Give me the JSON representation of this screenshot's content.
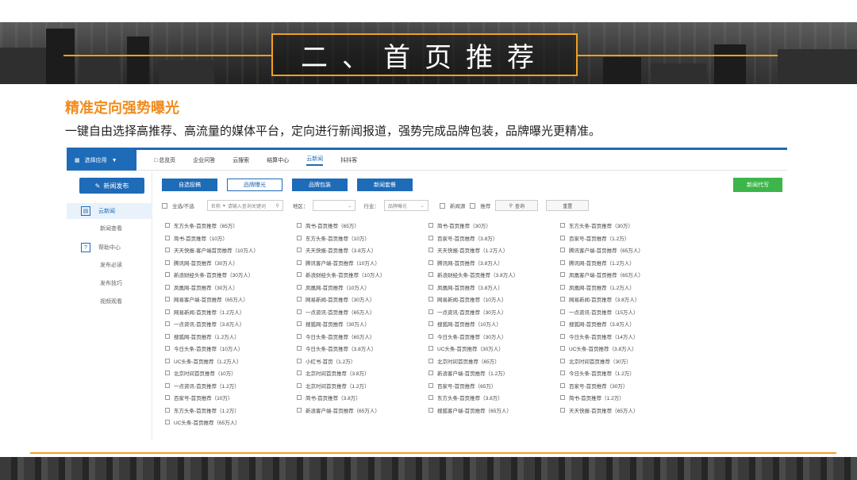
{
  "banner": {
    "title": "二、首页推荐"
  },
  "heading": "精准定向强势曝光",
  "subtitle": "一键自由选择高推荐、高流量的媒体平台，定向进行新闻报道，强势完成品牌包装，品牌曝光更精准。",
  "topnav": {
    "app_select": "选择应用",
    "items": [
      "总览页",
      "企业问答",
      "云搜索",
      "结算中心",
      "云新闻",
      "抖抖客"
    ],
    "active": "云新闻"
  },
  "sidebar": {
    "publish": "新闻发布",
    "group1": "云新闻",
    "group1_sub": "新闻查看",
    "group2": "帮助中心",
    "group2_subs": [
      "发布必读",
      "发布技巧",
      "视频观看"
    ]
  },
  "tabs": [
    "自选投稿",
    "品牌曝光",
    "品牌包装",
    "新闻套餐"
  ],
  "write_button": "新闻代写",
  "filter": {
    "select_all": "全选/不选",
    "name_label": "名称",
    "name_placeholder": "请输入查询关键词",
    "region_label": "地区：",
    "industry_label": "行业：",
    "industry_value": "品牌曝光",
    "option_a": "新闻源",
    "option_b": "推荐",
    "query": "查询",
    "reset": "重置"
  },
  "items": [
    [
      "东方头条-首页推荐（65万）",
      "简书-首页推荐（65万）",
      "简书-首页推荐（30万）",
      "东方头条-首页推荐（30万）"
    ],
    [
      "简书-首页推荐（10万）",
      "东方头条-首页推荐（10万）",
      "百家号-首页推荐（3.8万）",
      "百家号-首页推荐（1.2万）"
    ],
    [
      "天天快报-客户端首页推荐（10万人）",
      "天天快报-首页推荐（3.8万人）",
      "天天快报-首页推荐（1.2万人）",
      "腾讯客户端-首页推荐（65万人）"
    ],
    [
      "腾讯网-首页推荐（30万人）",
      "腾讯客户端-首页推荐（10万人）",
      "腾讯网-首页推荐（3.8万人）",
      "腾讯网-首页推荐（1.2万人）"
    ],
    [
      "新浪财经头条-首页推荐（30万人）",
      "新浪财经头条-首页推荐（10万人）",
      "新浪财经头条-首页推荐（3.8万人）",
      "凤凰客户端-首页推荐（65万人）"
    ],
    [
      "凤凰网-首页推荐（30万人）",
      "凤凰网-首页推荐（10万人）",
      "凤凰网-首页推荐（3.8万人）",
      "凤凰网-首页推荐（1.2万人）"
    ],
    [
      "网易客户端-首页推荐（65万人）",
      "网易新闻-首页推荐（30万人）",
      "网易新闻-首页推荐（10万人）",
      "网易新闻-首页推荐（3.8万人）"
    ],
    [
      "网易新闻-首页推荐（1.2万人）",
      "一点资讯-首页推荐（65万人）",
      "一点资讯-首页推荐（30万人）",
      "一点资讯-首页推荐（15万人）"
    ],
    [
      "一点资讯-首页推荐（3.8万人）",
      "搜狐网-首页推荐（30万人）",
      "搜狐网-首页推荐（10万人）",
      "搜狐网-首页推荐（3.8万人）"
    ],
    [
      "搜狐网-首页推荐（1.2万人）",
      "今日头条-首页推荐（65万人）",
      "今日头条-首页推荐（30万人）",
      "今日头条-首页推荐（14万人）"
    ],
    [
      "今日头条-首页推荐（10万人）",
      "今日头条-首页推荐（3.8万人）",
      "UC头条-首页推荐（30万人）",
      "UC头条-首页推荐（3.8万人）"
    ],
    [
      "UC头条-首页推荐（1.2万人）",
      "小红书-首页（1.2万）",
      "北京时间首页推荐（65万）",
      "北京时间首页推荐（30万）"
    ],
    [
      "北京时间首页推荐（10万）",
      "北京时间首页推荐（3.8万）",
      "新浪客户端-首页推荐（1.2万）",
      "今日头条-首页推荐（1.2万）"
    ],
    [
      "一点资讯-首页推荐（1.2万）",
      "北京时间首页推荐（1.2万）",
      "百家号-首页推荐（65万）",
      "百家号-首页推荐（30万）"
    ],
    [
      "百家号-首页推荐（10万）",
      "简书-首页推荐（3.8万）",
      "东方头条-首页推荐（3.8万）",
      "简书-首页推荐（1.2万）"
    ],
    [
      "东方头条-首页推荐（1.2万）",
      "新浪客户端-首页推荐（65万人）",
      "搜狐客户端-首页推荐（65万人）",
      "天天快报-首页推荐（65万人）"
    ],
    [
      "UC头条-首页推荐（65万人）"
    ]
  ]
}
